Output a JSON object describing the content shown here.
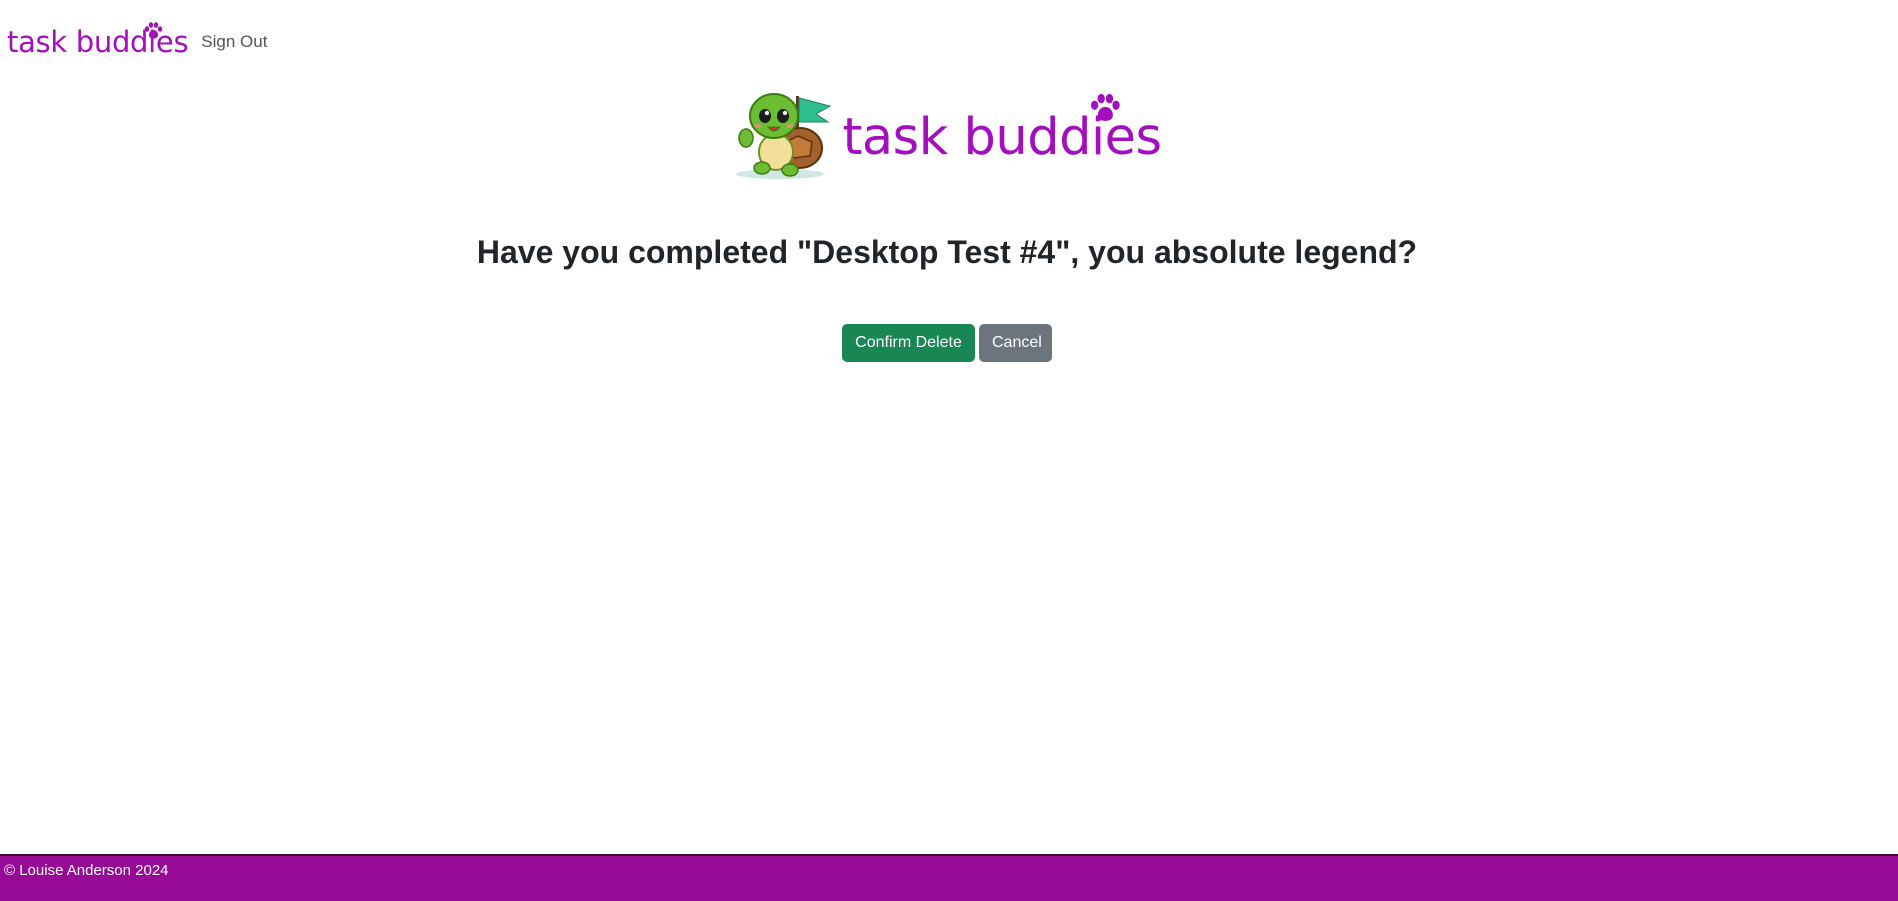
{
  "nav": {
    "brand": "task buddies",
    "sign_out": "Sign Out"
  },
  "hero": {
    "brand": "task buddies",
    "mascot": "turtle-with-flag"
  },
  "prompt": {
    "question": "Have you completed \"Desktop Test #4\", you absolute legend?"
  },
  "actions": {
    "confirm_label": "Confirm Delete",
    "cancel_label": "Cancel"
  },
  "footer": {
    "copyright": "© Louise Anderson 2024"
  },
  "colors": {
    "brand": "#a30fbf",
    "confirm": "#198754",
    "cancel": "#6c757d",
    "footer": "#970a97"
  },
  "icons": {
    "brand_accent": "paw-icon"
  }
}
